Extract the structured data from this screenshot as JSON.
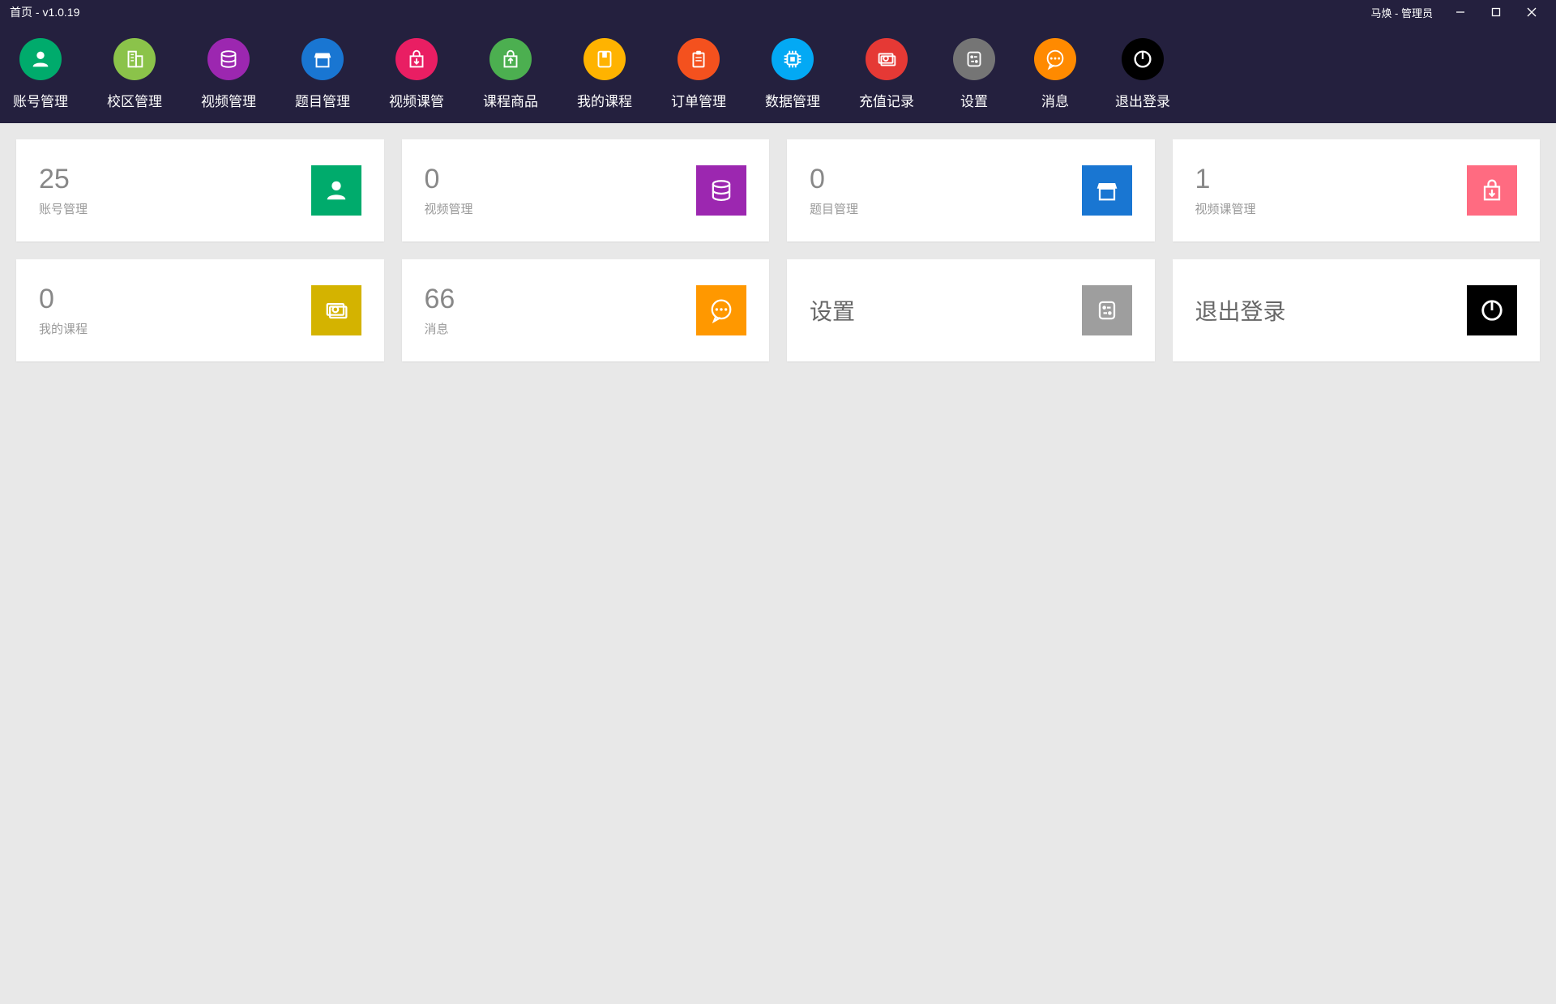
{
  "titlebar": {
    "title": "首页 - v1.0.19",
    "user": "马焕 - 管理员"
  },
  "nav": [
    {
      "label": "账号管理",
      "color": "#00ab6c",
      "icon": "user"
    },
    {
      "label": "校区管理",
      "color": "#8bc34a",
      "icon": "building"
    },
    {
      "label": "视频管理",
      "color": "#9c27b0",
      "icon": "database"
    },
    {
      "label": "题目管理",
      "color": "#1976d2",
      "icon": "shop"
    },
    {
      "label": "视频课管",
      "color": "#e91e63",
      "icon": "bag-down"
    },
    {
      "label": "课程商品",
      "color": "#4caf50",
      "icon": "bag-up"
    },
    {
      "label": "我的课程",
      "color": "#ffb300",
      "icon": "book"
    },
    {
      "label": "订单管理",
      "color": "#f4511e",
      "icon": "clipboard"
    },
    {
      "label": "数据管理",
      "color": "#03a9f4",
      "icon": "chip"
    },
    {
      "label": "充值记录",
      "color": "#e53935",
      "icon": "money"
    },
    {
      "label": "设置",
      "color": "#757575",
      "icon": "settings"
    },
    {
      "label": "消息",
      "color": "#ff8a00",
      "icon": "message"
    },
    {
      "label": "退出登录",
      "color": "#000000",
      "icon": "power"
    }
  ],
  "cards": [
    {
      "count": "25",
      "label": "账号管理",
      "color": "#00ab6c",
      "icon": "user"
    },
    {
      "count": "0",
      "label": "视频管理",
      "color": "#9c27b0",
      "icon": "database"
    },
    {
      "count": "0",
      "label": "题目管理",
      "color": "#1976d2",
      "icon": "shop"
    },
    {
      "count": "1",
      "label": "视频课管理",
      "color": "#ff6b81",
      "icon": "bag-down"
    },
    {
      "count": "0",
      "label": "我的课程",
      "color": "#d4b300",
      "icon": "money"
    },
    {
      "count": "66",
      "label": "消息",
      "color": "#ff9800",
      "icon": "message"
    },
    {
      "title": "设置",
      "color": "#9e9e9e",
      "icon": "settings"
    },
    {
      "title": "退出登录",
      "color": "#000000",
      "icon": "power"
    }
  ]
}
